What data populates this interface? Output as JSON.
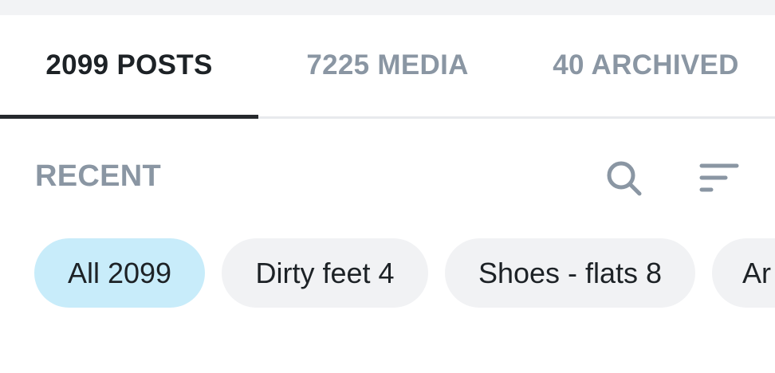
{
  "tabs": [
    {
      "label": "2099 POSTS",
      "active": true
    },
    {
      "label": "7225 MEDIA",
      "active": false
    },
    {
      "label": "40 ARCHIVED",
      "active": false
    }
  ],
  "section": {
    "title": "RECENT",
    "search_icon": "search-icon",
    "sort_icon": "sort-icon"
  },
  "chips": [
    {
      "label": "All 2099",
      "selected": true
    },
    {
      "label": "Dirty feet 4",
      "selected": false
    },
    {
      "label": "Shoes - flats 8",
      "selected": false
    },
    {
      "label": "Ar",
      "selected": false
    }
  ],
  "colors": {
    "active_tab_text": "#1d2226",
    "inactive_tab_text": "#8a96a3",
    "indicator": "#26292d",
    "chip_selected_bg": "#c8ecfa",
    "chip_bg": "#f1f2f4"
  }
}
